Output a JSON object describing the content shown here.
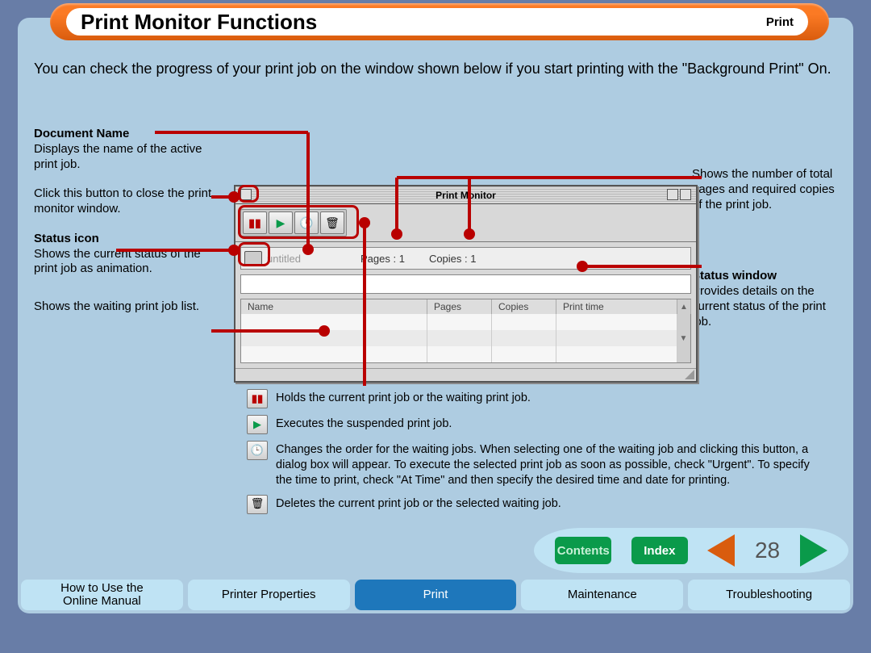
{
  "title": "Print Monitor Functions",
  "section": "Print",
  "intro": "You can check the progress of your print job on the window shown below if you start printing with the \"Background Print\" On.",
  "left": {
    "doc_name_h": "Document Name",
    "doc_name_t": "Displays the name of the active print job.",
    "close_t": "Click this button to close the print monitor window.",
    "status_icon_h": "Status icon",
    "status_icon_t": "Shows the current status of the print job as animation.",
    "waiting_t": "Shows the waiting print job list."
  },
  "right": {
    "pages_t": "Shows the number of total pages and required copies of the print job.",
    "status_win_h": "Status window",
    "status_win_t": "Provides details on the current status of the print job."
  },
  "pm": {
    "window_title": "Print Monitor",
    "doc": "untitled",
    "pages_label": "Pages : 1",
    "copies_label": "Copies : 1",
    "col_name": "Name",
    "col_pages": "Pages",
    "col_copies": "Copies",
    "col_time": "Print time"
  },
  "legend": {
    "pause": "Holds the current print job or the waiting print job.",
    "play": "Executes the suspended print job.",
    "clock": "Changes the order for the waiting jobs. When selecting one of the waiting job and clicking this button, a dialog box will appear. To execute the selected print job as soon as possible, check \"Urgent\". To specify the time to print, check \"At Time\" and then specify the desired time and date for printing.",
    "trash": "Deletes the current print job or the selected waiting job."
  },
  "nav": {
    "contents": "Contents",
    "index": "Index",
    "page": "28"
  },
  "tabs": {
    "t1a": "How to Use the",
    "t1b": "Online Manual",
    "t2": "Printer Properties",
    "t3": "Print",
    "t4": "Maintenance",
    "t5": "Troubleshooting"
  }
}
